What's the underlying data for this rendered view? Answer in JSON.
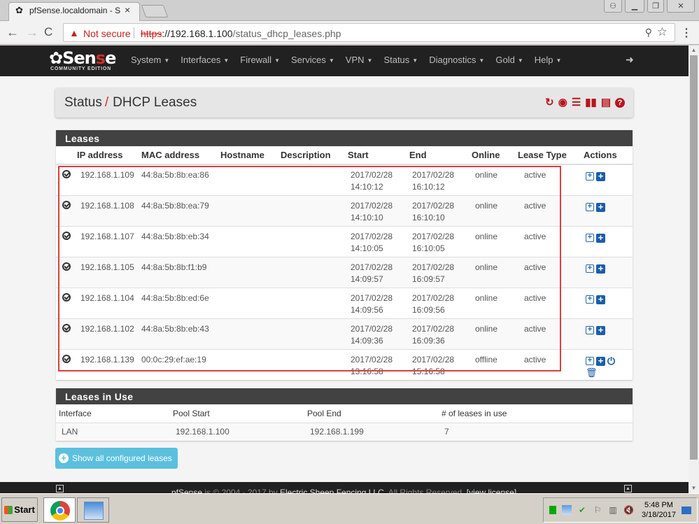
{
  "browser": {
    "tab_title": "pfSense.localdomain - Stat",
    "tab_icon": "pfsense-favicon",
    "security_label": "Not secure",
    "url_scheme": "https",
    "url_host": "://192.168.1.100",
    "url_path": "/status_dhcp_leases.php"
  },
  "nav": {
    "logo_main_a": "Sen",
    "logo_main_b": "s",
    "logo_main_c": "e",
    "logo_sub": "COMMUNITY EDITION",
    "menu": [
      "System",
      "Interfaces",
      "Firewall",
      "Services",
      "VPN",
      "Status",
      "Diagnostics",
      "Gold",
      "Help"
    ]
  },
  "breadcrumb": {
    "parent": "Status",
    "separator": "/",
    "current": "DHCP Leases",
    "icons": [
      "reload-icon",
      "stop-circle-icon",
      "sliders-icon",
      "bar-chart-icon",
      "log-list-icon",
      "help-icon"
    ]
  },
  "leases": {
    "title": "Leases",
    "columns": [
      "",
      "IP address",
      "MAC address",
      "Hostname",
      "Description",
      "Start",
      "End",
      "Online",
      "Lease Type",
      "Actions"
    ],
    "rows": [
      {
        "ip": "192.168.1.109",
        "mac": "44:8a:5b:8b:ea:86",
        "hostname": "",
        "description": "",
        "start_date": "2017/02/28",
        "start_time": "14:10:12",
        "end_date": "2017/02/28",
        "end_time": "16:10:12",
        "online": "online",
        "type": "active"
      },
      {
        "ip": "192.168.1.108",
        "mac": "44:8a:5b:8b:ea:79",
        "hostname": "",
        "description": "",
        "start_date": "2017/02/28",
        "start_time": "14:10:10",
        "end_date": "2017/02/28",
        "end_time": "16:10:10",
        "online": "online",
        "type": "active"
      },
      {
        "ip": "192.168.1.107",
        "mac": "44:8a:5b:8b:eb:34",
        "hostname": "",
        "description": "",
        "start_date": "2017/02/28",
        "start_time": "14:10:05",
        "end_date": "2017/02/28",
        "end_time": "16:10:05",
        "online": "online",
        "type": "active"
      },
      {
        "ip": "192.168.1.105",
        "mac": "44:8a:5b:8b:f1:b9",
        "hostname": "",
        "description": "",
        "start_date": "2017/02/28",
        "start_time": "14:09:57",
        "end_date": "2017/02/28",
        "end_time": "16:09:57",
        "online": "online",
        "type": "active"
      },
      {
        "ip": "192.168.1.104",
        "mac": "44:8a:5b:8b:ed:6e",
        "hostname": "",
        "description": "",
        "start_date": "2017/02/28",
        "start_time": "14:09:56",
        "end_date": "2017/02/28",
        "end_time": "16:09:56",
        "online": "online",
        "type": "active"
      },
      {
        "ip": "192.168.1.102",
        "mac": "44:8a:5b:8b:eb:43",
        "hostname": "",
        "description": "",
        "start_date": "2017/02/28",
        "start_time": "14:09:36",
        "end_date": "2017/02/28",
        "end_time": "16:09:36",
        "online": "online",
        "type": "active"
      },
      {
        "ip": "192.168.1.139",
        "mac": "00:0c:29:ef:ae:19",
        "hostname": "",
        "description": "",
        "start_date": "2017/02/28",
        "start_time": "13:16:58",
        "end_date": "2017/02/28",
        "end_time": "15:16:58",
        "online": "offline",
        "type": "active",
        "extra_actions": true
      }
    ]
  },
  "in_use": {
    "title": "Leases in Use",
    "columns": [
      "Interface",
      "Pool Start",
      "Pool End",
      "# of leases in use"
    ],
    "rows": [
      {
        "interface": "LAN",
        "pool_start": "192.168.1.100",
        "pool_end": "192.168.1.199",
        "count": "7"
      }
    ]
  },
  "show_all_button": "Show all configured leases",
  "footer": {
    "product": "pfSense",
    "copyright": "is © 2004 - 2017 by",
    "company": "Electric Sheep Fencing LLC",
    "rights": ". All Rights Reserved.",
    "license_link": "[view license]"
  },
  "taskbar": {
    "start_label": "Start",
    "time": "5:48 PM",
    "date": "3/18/2017"
  },
  "colors": {
    "accent_red": "#c9302c",
    "navbar_bg": "#212121",
    "panel_head_bg": "#424242",
    "info_button": "#5bc0de",
    "action_blue": "#1b5ea8",
    "highlight_box": "#d9403f"
  }
}
